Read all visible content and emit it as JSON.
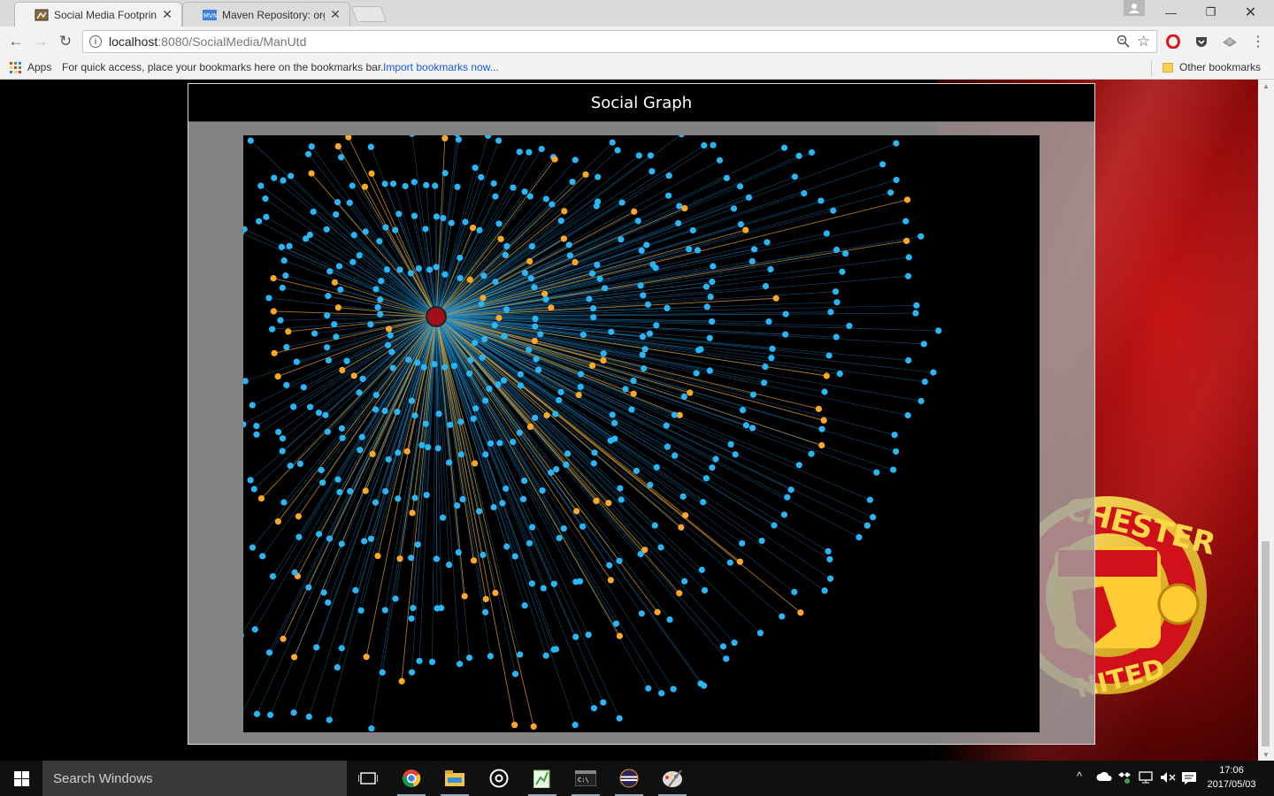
{
  "browser": {
    "tabs": [
      {
        "title": "Social Media Footprint",
        "active": true
      },
      {
        "title": "Maven Repository: org.m",
        "active": false
      }
    ],
    "url": {
      "host": "localhost",
      "path": ":8080/SocialMedia/ManUtd"
    },
    "bookmarks_bar": {
      "apps_label": "Apps",
      "hint": "For quick access, place your bookmarks here on the bookmarks bar.",
      "import_link": "Import bookmarks now...",
      "other": "Other bookmarks"
    },
    "tab_favicon_text": "MVN"
  },
  "page": {
    "panel_title": "Social Graph",
    "graph": {
      "hub_color": "#a0101a",
      "node_color_primary": "#29b6f6",
      "node_color_secondary": "#ffa726",
      "edge_color_primary": "#1e88c8",
      "edge_color_secondary": "#e0a030"
    }
  },
  "taskbar": {
    "search_placeholder": "Search Windows",
    "time": "17:06",
    "date": "2017/05/03"
  }
}
